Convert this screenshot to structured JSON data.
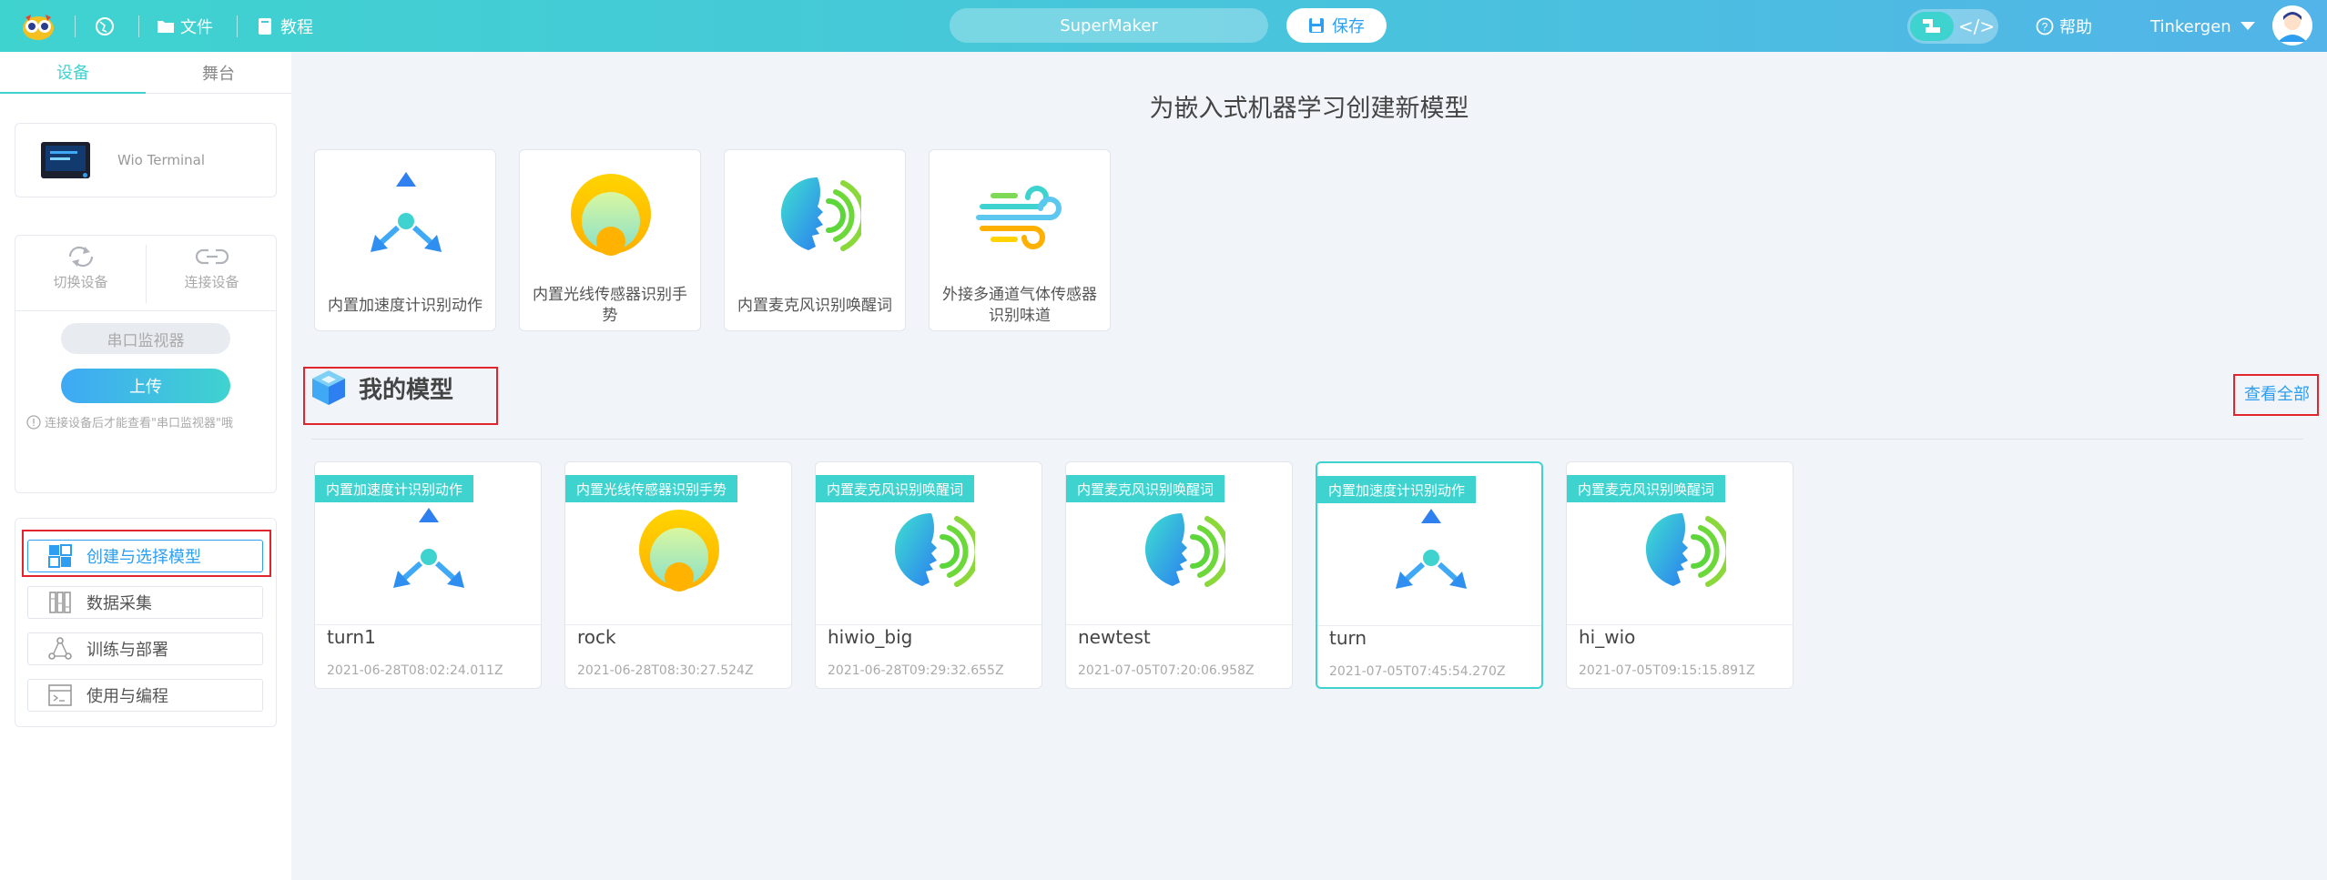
{
  "header": {
    "file_label": "文件",
    "tutorial_label": "教程",
    "project_name": "SuperMaker",
    "save_label": "保存",
    "help_label": "帮助",
    "user_name": "Tinkergen",
    "accent": "#3fd3cf"
  },
  "sidebar": {
    "tabs": [
      {
        "label": "设备"
      },
      {
        "label": "舞台"
      }
    ],
    "device_name": "Wio Terminal",
    "switch_label": "切换设备",
    "connect_label": "连接设备",
    "serial_label": "串口监视器",
    "upload_label": "上传",
    "hint": "连接设备后才能查看\"串口监视器\"哦",
    "nav": [
      {
        "label": "创建与选择模型",
        "icon": "grid-icon"
      },
      {
        "label": "数据采集",
        "icon": "data-icon"
      },
      {
        "label": "训练与部署",
        "icon": "network-icon"
      },
      {
        "label": "使用与编程",
        "icon": "code-window-icon"
      }
    ]
  },
  "main": {
    "title": "为嵌入式机器学习创建新模型",
    "templates": [
      {
        "label": "内置加速度计识别动作",
        "icon": "accelerometer-icon"
      },
      {
        "label": "内置光线传感器识别手势",
        "icon": "light-sensor-icon"
      },
      {
        "label": "内置麦克风识别唤醒词",
        "icon": "microphone-voice-icon"
      },
      {
        "label": "外接多通道气体传感器识别味道",
        "icon": "gas-wind-icon"
      }
    ],
    "my_models_title": "我的模型",
    "view_all": "查看全部",
    "models": [
      {
        "tag": "内置加速度计识别动作",
        "name": "turn1",
        "date": "2021-06-28T08:02:24.011Z",
        "icon": "accelerometer-icon"
      },
      {
        "tag": "内置光线传感器识别手势",
        "name": "rock",
        "date": "2021-06-28T08:30:27.524Z",
        "icon": "light-sensor-icon"
      },
      {
        "tag": "内置麦克风识别唤醒词",
        "name": "hiwio_big",
        "date": "2021-06-28T09:29:32.655Z",
        "icon": "microphone-voice-icon"
      },
      {
        "tag": "内置麦克风识别唤醒词",
        "name": "newtest",
        "date": "2021-07-05T07:20:06.958Z",
        "icon": "microphone-voice-icon"
      },
      {
        "tag": "内置加速度计识别动作",
        "name": "turn",
        "date": "2021-07-05T07:45:54.270Z",
        "icon": "accelerometer-icon"
      },
      {
        "tag": "内置麦克风识别唤醒词",
        "name": "hi_wio",
        "date": "2021-07-05T09:15:15.891Z",
        "icon": "microphone-voice-icon"
      }
    ]
  }
}
